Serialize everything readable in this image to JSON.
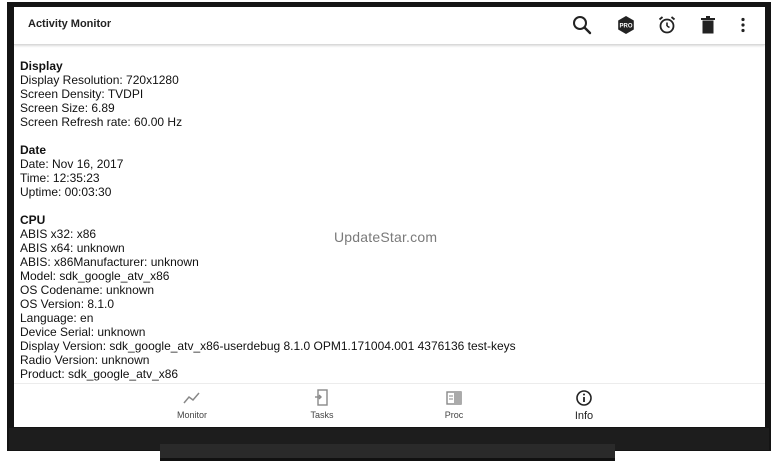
{
  "app": {
    "title": "Activity Monitor"
  },
  "watermark": "UpdateStar.com",
  "sections": {
    "display": {
      "title": "Display",
      "lines": [
        "Display Resolution: 720x1280",
        "Screen Density: TVDPI",
        "Screen Size: 6.89",
        "Screen Refresh rate: 60.00 Hz"
      ]
    },
    "date": {
      "title": "Date",
      "lines": [
        "Date: Nov 16, 2017",
        "Time: 12:35:23",
        "Uptime: 00:03:30"
      ]
    },
    "cpu": {
      "title": "CPU",
      "lines": [
        "ABIS x32: x86",
        "ABIS x64: unknown",
        "ABIS: x86Manufacturer: unknown",
        "Model: sdk_google_atv_x86",
        "OS Codename: unknown",
        "OS Version: 8.1.0",
        "Language: en",
        "Device Serial: unknown",
        "Display Version: sdk_google_atv_x86-userdebug 8.1.0 OPM1.171004.001 4376136 test-keys",
        "Radio Version: unknown",
        "Product: sdk_google_atv_x86"
      ]
    }
  },
  "nav": {
    "monitor": "Monitor",
    "tasks": "Tasks",
    "proc": "Proc",
    "info": "Info"
  },
  "icons": {
    "search": "search-icon",
    "pro": "pro-badge-icon",
    "alarm": "alarm-clock-icon",
    "trash": "trash-icon",
    "more": "more-vert-icon"
  }
}
